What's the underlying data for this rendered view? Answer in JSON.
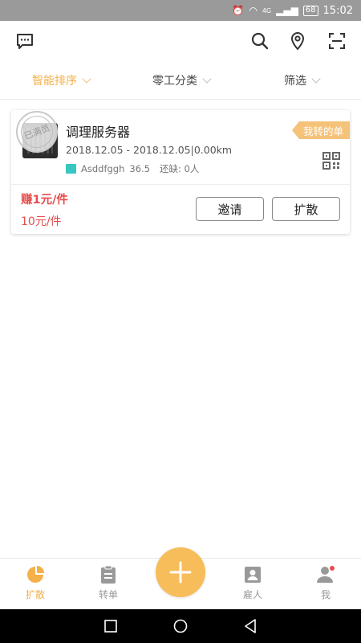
{
  "status_bar": {
    "time": "15:02",
    "battery": "68",
    "network": "4G"
  },
  "header": {
    "icons": [
      "message-icon",
      "search-icon",
      "location-icon",
      "scan-icon"
    ]
  },
  "filters": [
    {
      "label": "智能排序",
      "active": true
    },
    {
      "label": "零工分类",
      "active": false
    },
    {
      "label": "筛选",
      "active": false
    }
  ],
  "job": {
    "title": "调理服务器",
    "date_range": "2018.12.05 - 2018.12.05",
    "distance": "0.00km",
    "company": "Asddfggh",
    "score": "36.5",
    "shortage": "还缺: 0人",
    "stamp": "已满员",
    "badge": "我转的单",
    "earn": "赚1元/件",
    "price": "10元/件",
    "invite_label": "邀请",
    "spread_label": "扩散"
  },
  "tabs": [
    {
      "label": "扩散",
      "active": true
    },
    {
      "label": "转单",
      "active": false
    },
    {
      "label": "雇人",
      "active": false
    },
    {
      "label": "我",
      "active": false
    }
  ],
  "colors": {
    "accent": "#f5b04a",
    "price": "#e74c4c",
    "badge": "#f5c27a",
    "fab": "#f7bd5b"
  }
}
